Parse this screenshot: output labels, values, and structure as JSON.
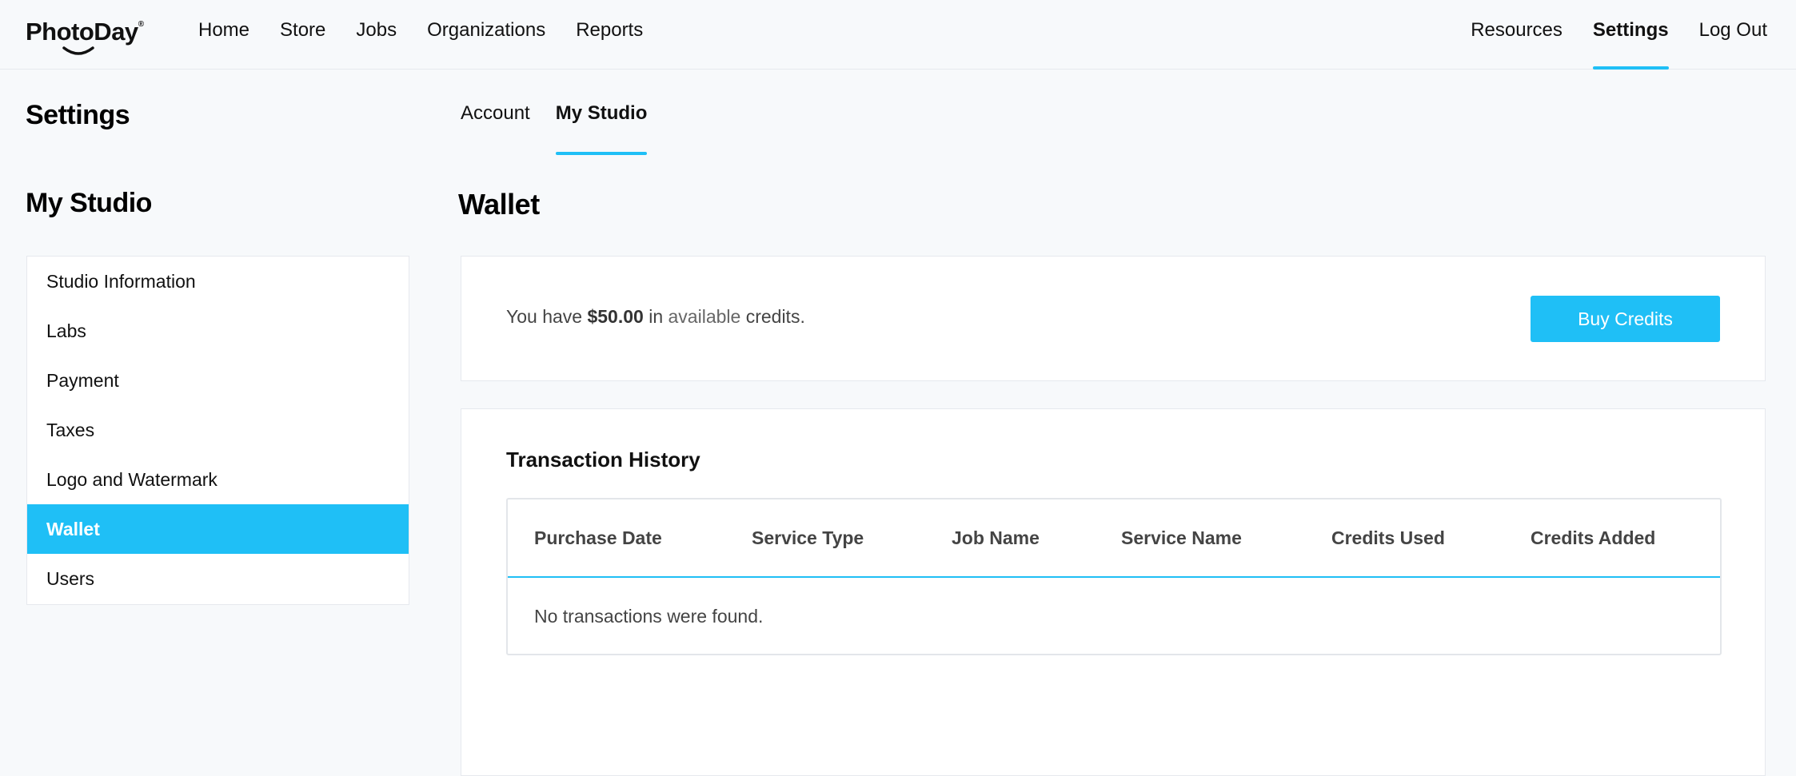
{
  "brand": {
    "name": "PhotoDay",
    "mark": "®",
    "accent": "#1fbff6"
  },
  "nav": {
    "left": [
      "Home",
      "Store",
      "Jobs",
      "Organizations",
      "Reports"
    ],
    "right": [
      "Resources",
      "Settings",
      "Log Out"
    ],
    "active": "Settings"
  },
  "page": {
    "title": "Settings"
  },
  "tabs": {
    "items": [
      "Account",
      "My Studio"
    ],
    "active": "My Studio"
  },
  "sidebar": {
    "title": "My Studio",
    "items": [
      "Studio Information",
      "Labs",
      "Payment",
      "Taxes",
      "Logo and Watermark",
      "Wallet",
      "Users"
    ],
    "active": "Wallet"
  },
  "wallet": {
    "title": "Wallet",
    "credits_prefix": "You have",
    "credits_amount": "$50.00",
    "credits_in": "in",
    "credits_available": "available",
    "credits_suffix": "credits.",
    "buy_label": "Buy Credits"
  },
  "transactions": {
    "title": "Transaction History",
    "columns": [
      "Purchase Date",
      "Service Type",
      "Job Name",
      "Service Name",
      "Credits Used",
      "Credits Added"
    ],
    "empty_message": "No transactions were found."
  }
}
